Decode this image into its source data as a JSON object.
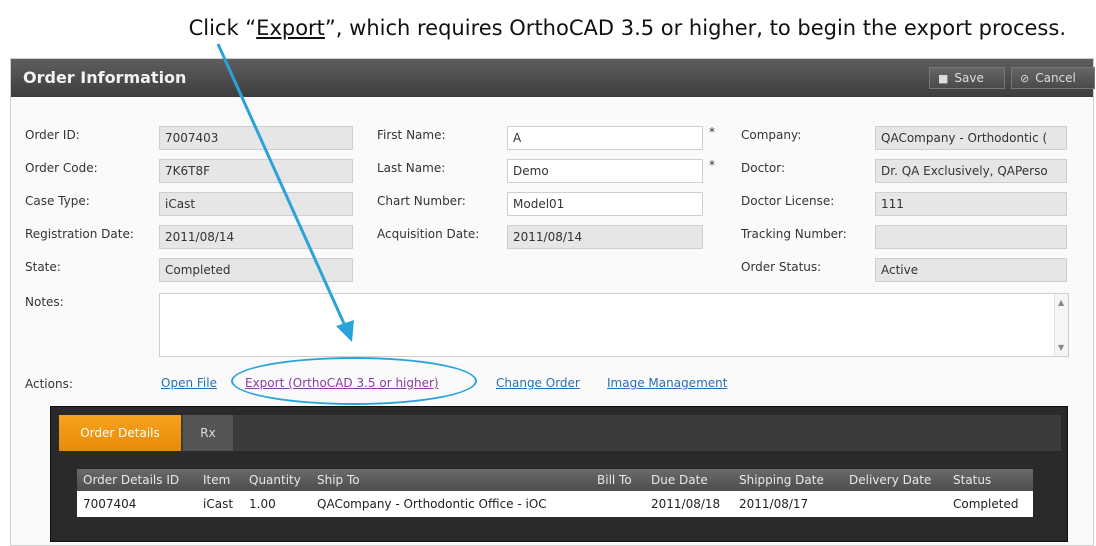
{
  "instruction": {
    "prefix": "Click “",
    "emphasis": "Export",
    "suffix": "”, which requires OrthoCAD 3.5 or higher, to begin the export process."
  },
  "window": {
    "title": "Order Information",
    "save_label": "Save",
    "cancel_label": "Cancel"
  },
  "order": {
    "order_id_label": "Order ID:",
    "order_id": "7007403",
    "order_code_label": "Order Code:",
    "order_code": "7K6T8F",
    "case_type_label": "Case Type:",
    "case_type": "iCast",
    "registration_date_label": "Registration Date:",
    "registration_date": "2011/08/14",
    "state_label": "State:",
    "state": "Completed",
    "first_name_label": "First Name:",
    "first_name": "A",
    "last_name_label": "Last Name:",
    "last_name": "Demo",
    "chart_number_label": "Chart Number:",
    "chart_number": "Model01",
    "acquisition_date_label": "Acquisition Date:",
    "acquisition_date": "2011/08/14",
    "company_label": "Company:",
    "company": "QACompany - Orthodontic (",
    "doctor_label": "Doctor:",
    "doctor": "Dr. QA Exclusively, QAPerso",
    "doctor_license_label": "Doctor License:",
    "doctor_license": "111",
    "tracking_number_label": "Tracking Number:",
    "tracking_number": "",
    "order_status_label": "Order Status:",
    "order_status": "Active",
    "notes_label": "Notes:",
    "required_mark": "*"
  },
  "actions": {
    "label": "Actions:",
    "open_file": "Open File",
    "export": "Export (OrthoCAD 3.5 or higher)",
    "change_order": "Change Order",
    "image_management": "Image Management"
  },
  "details": {
    "tabs": [
      "Order Details",
      "Rx"
    ],
    "columns": [
      "Order Details ID",
      "Item",
      "Quantity",
      "Ship To",
      "Bill To",
      "Due Date",
      "Shipping Date",
      "Delivery Date",
      "Status"
    ],
    "rows": [
      [
        "7007404",
        "iCast",
        "1.00",
        "QACompany - Orthodontic Office - iOC",
        "",
        "2011/08/18",
        "2011/08/17",
        "",
        "Completed"
      ]
    ]
  },
  "colors": {
    "accent_tab": "#f29a14",
    "annotation": "#2aa3d8",
    "link": "#2a6fb5"
  }
}
